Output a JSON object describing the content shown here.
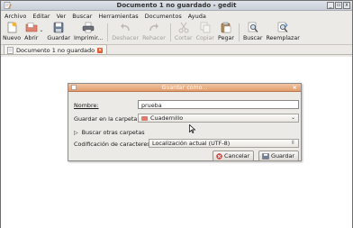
{
  "window": {
    "title": "Documento 1 no guardado - gedit",
    "buttons": [
      "_",
      "▫",
      "x"
    ]
  },
  "menubar": [
    "Archivo",
    "Editar",
    "Ver",
    "Buscar",
    "Herramientas",
    "Documentos",
    "Ayuda"
  ],
  "toolbar": {
    "nuevo": "Nuevo",
    "abrir": "Abrir",
    "guardar": "Guardar",
    "imprimir": "Imprimir...",
    "deshacer": "Deshacer",
    "rehacer": "Rehacer",
    "cortar": "Cortar",
    "copiar": "Copiar",
    "pegar": "Pegar",
    "buscar": "Buscar",
    "reemplazar": "Reemplazar"
  },
  "tab": {
    "label": "Documento 1 no guardado"
  },
  "dialog": {
    "title": "Guardar como...",
    "name_label": "Nombre:",
    "name_value": "prueba",
    "folder_label": "Guardar en la carpeta:",
    "folder_value": "Cuadernillo",
    "browse_label": "Buscar otras carpetas",
    "encoding_label": "Codificación de caracteres:",
    "encoding_value": "Localización actual (UTF-8)",
    "cancel": "Cancelar",
    "save": "Guardar"
  }
}
